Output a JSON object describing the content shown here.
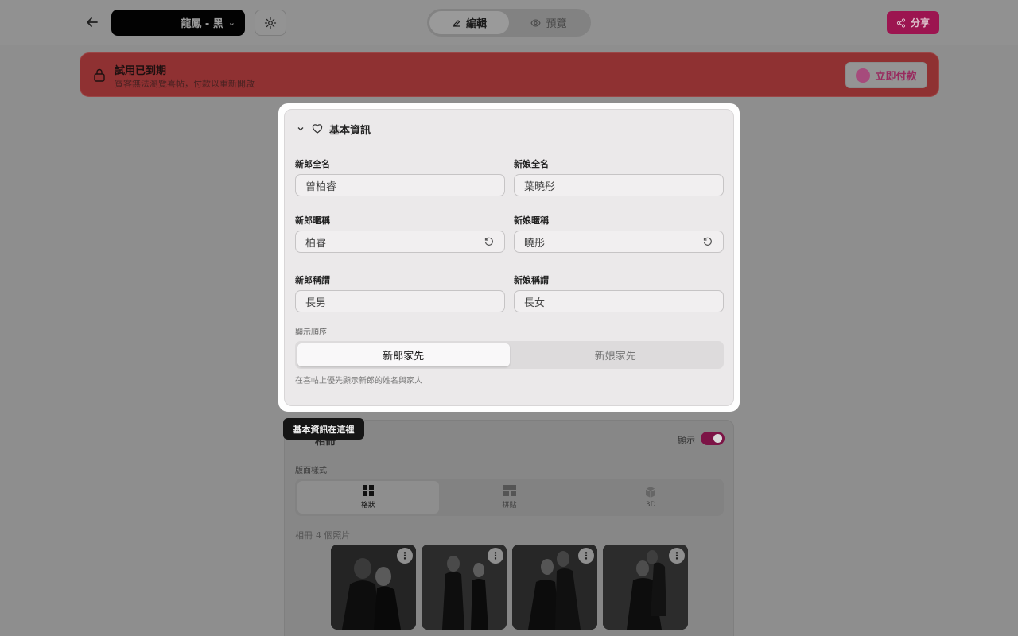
{
  "header": {
    "theme_label": "龍鳳 - 黑",
    "mode_tabs": [
      {
        "label": "編輯",
        "active": true
      },
      {
        "label": "預覽",
        "active": false
      }
    ],
    "share_label": "分享",
    "accent_color": "#e0197a"
  },
  "banner": {
    "title": "試用已到期",
    "subtitle": "賓客無法瀏覽喜帖，付款以重新開啟",
    "pay_label": "立即付款",
    "color": "#e25456"
  },
  "basic_info": {
    "title": "基本資訊",
    "groom_name_label": "新郎全名",
    "groom_name_value": "曾柏睿",
    "bride_name_label": "新娘全名",
    "bride_name_value": "葉曉彤",
    "groom_nick_label": "新郎暱稱",
    "groom_nick_value": "柏睿",
    "bride_nick_label": "新娘暱稱",
    "bride_nick_value": "曉彤",
    "groom_title_label": "新郎稱謂",
    "groom_title_value": "長男",
    "bride_title_label": "新娘稱謂",
    "bride_title_value": "長女",
    "order_label": "顯示順序",
    "order_options": [
      {
        "label": "新郎家先",
        "active": true
      },
      {
        "label": "新娘家先",
        "active": false
      }
    ],
    "hint": "在喜帖上優先顯示新郎的姓名與家人"
  },
  "tooltip": "基本資訊在這裡",
  "album": {
    "title": "相冊",
    "show_label": "顯示",
    "show_enabled": true,
    "layout_label": "版面樣式",
    "layouts": [
      {
        "label": "格狀",
        "icon": "grid-icon",
        "active": true
      },
      {
        "label": "拼貼",
        "icon": "collage-icon",
        "active": false
      },
      {
        "label": "3D",
        "icon": "cube-icon",
        "active": false
      }
    ],
    "count_label": "相冊",
    "count_text": "4 個照片",
    "photos": [
      {
        "alt": "couple-photo-1"
      },
      {
        "alt": "couple-photo-2"
      },
      {
        "alt": "couple-photo-3"
      },
      {
        "alt": "couple-photo-4"
      }
    ]
  }
}
